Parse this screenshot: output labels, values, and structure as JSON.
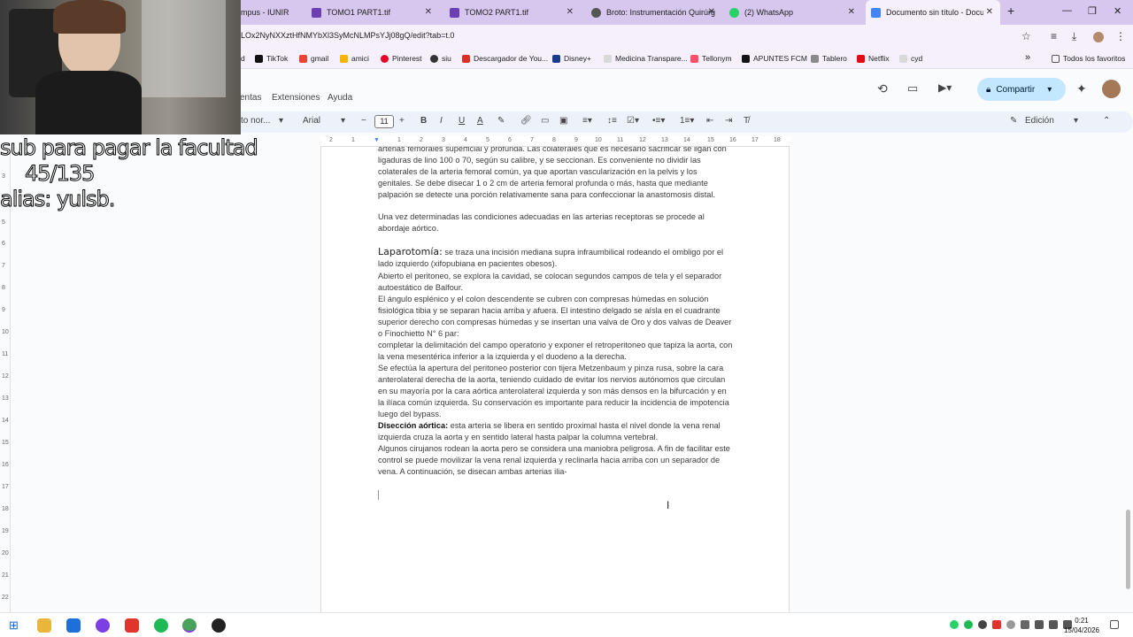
{
  "browser": {
    "tabs": [
      {
        "label": "mpus - IUNIR"
      },
      {
        "label": "TOMO1 PART1.tif"
      },
      {
        "label": "TOMO2 PART1.tif"
      },
      {
        "label": "Broto: Instrumentación Quirúrg"
      },
      {
        "label": "(2) WhatsApp"
      },
      {
        "label": "Documento sin título - Docum"
      }
    ],
    "new_tab": "+",
    "url": "LOx2NyNXXztHfNMYbXl3SyMcNLMPsYJj08gQ/edit?tab=t.0",
    "bookmarks": [
      "d",
      "TikTok",
      "gmail",
      "amici",
      "Pinterest",
      "siu",
      "Descargador de You...",
      "Disney+",
      "Medicina Transpare...",
      "Tellonym",
      "APUNTES FCM",
      "Tablero",
      "Netflix",
      "cyd"
    ],
    "all_bookmarks": "Todos los favoritos"
  },
  "docs": {
    "menus": [
      "entas",
      "Extensiones",
      "Ayuda"
    ],
    "share_label": "Compartir",
    "style_label": "to nor...",
    "font": "Arial",
    "font_size": "11",
    "mode": "Edición"
  },
  "ruler": [
    "2",
    "1",
    "1",
    "2",
    "3",
    "4",
    "5",
    "6",
    "7",
    "8",
    "9",
    "10",
    "11",
    "12",
    "13",
    "14",
    "15",
    "16",
    "17",
    "18"
  ],
  "vruler": [
    "3",
    "4",
    "5",
    "6",
    "7",
    "8",
    "9",
    "10",
    "11",
    "12",
    "13",
    "14",
    "15",
    "16",
    "17",
    "18",
    "19",
    "20",
    "21",
    "22"
  ],
  "document": {
    "p1": "arterias femorales superficial y profunda. Las colaterales que es necesario sacrificar se ligan con ligaduras de lino 100 o 70, según su calibre, y se seccionan. Es conveniente no dividir las colaterales de la arteria femoral común, ya que aportan vascularización en la pelvis y los genitales. Se debe disecar 1 o 2 cm de arteria femoral profunda o más, hasta que mediante palpación se detecte una porción relativamente sana para confeccionar la anastomosis distal.",
    "p2": "Una vez determinadas las condiciones adecuadas en las arterias receptoras se procede al abordaje aórtico.",
    "p3_head": "Laparotomía:",
    "p3": " se traza una incisión mediana supra infraumbilical rodeando el ombligo por el lado izquierdo (xifopubiana en pacientes obesos).",
    "p4": "Abierto el peritoneo, se explora la cavidad, se colocan segundos campos de tela y el separador autoestático de Balfour.",
    "p5": "El ángulo esplénico y el colon descendente se cubren con compresas húmedas en solución fisiológica tibia y se separan hacia arriba y afuera. El intestino delgado se aísla en el cuadrante superior derecho con compresas húmedas y se insertan una valva de Oro y dos valvas de Deaver o Finochietto N° 6 par:",
    "p6": "completar la delimitación del campo operatorio y exponer el retroperitoneo que tapiza la aorta, con la vena mesentérica inferior a la izquierda y el duodeno a la derecha.",
    "p7": "Se efectúa la apertura del peritoneo posterior con tijera Metzenbaum y pinza rusa, sobre la cara anterolateral derecha de la aorta, teniendo cuidado de evitar los nervios autónomos que circulan en su mayoría por la cara aórtica anterolateral izquierda y son más densos en la bifurcación y en la ilíaca común izquierda. Su conservación es importante para reducir la incidencia de impotencia luego del bypass.",
    "p8_head": "Disección aórtica:",
    "p8": " esta arteria se libera en sentido proximal hasta el nivel donde la vena renal izquierda cruza la aorta y en sentido lateral hasta palpar la columna vertebral.",
    "p9": " Algunos cirujanos rodean la aorta pero se considera una maniobra peligrosa. A fin de facilitar este control se puede movilizar la vena renal izquierda y reclinarla hacia arriba con un separador de vena. A continuación, se disecan ambas arterias ilia-"
  },
  "overlay": {
    "line1": "sub para pagar la facultad",
    "line2": "45/135",
    "line3": "alias: yulsb."
  },
  "taskbar": {
    "time": "0:21",
    "date": "15/04/2026"
  },
  "colors": {
    "tabstrip": "#d7c6ee",
    "share": "#c2e7ff",
    "accent": "#7b3fe4"
  }
}
